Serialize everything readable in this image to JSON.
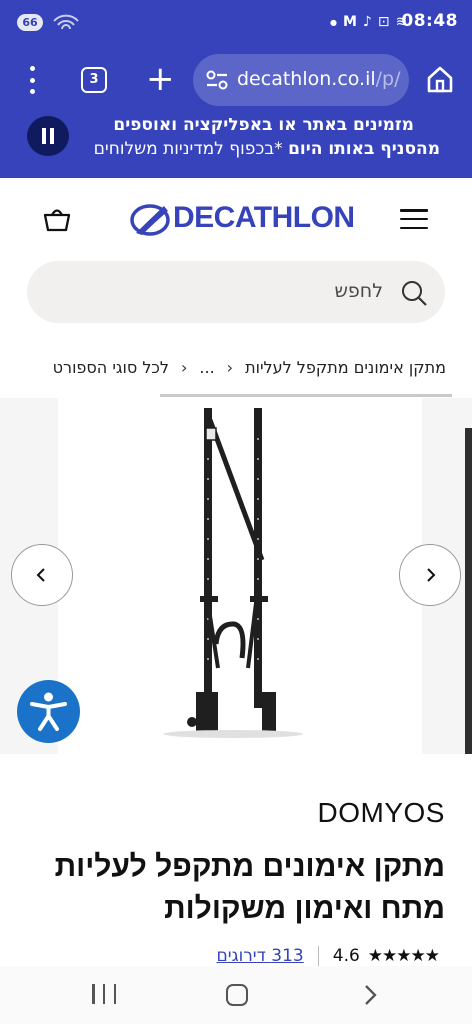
{
  "status_bar": {
    "badge": "66",
    "time": "08:48",
    "icons": [
      "dot-indicator",
      "gmail-icon",
      "tiktok-icon",
      "screenshot-icon",
      "wifi-icon"
    ]
  },
  "browser": {
    "tab_count": "3",
    "url_host": "decathlon.co.il",
    "url_path": "/p/"
  },
  "promo": {
    "line1": "מזמינים באתר או באפליקציה ואוספים",
    "line2_bold": "מהסניף באותו היום",
    "line2_rest": " *בכפוף למדיניות משלוחים"
  },
  "header": {
    "logo_text": "DECATHLON"
  },
  "search": {
    "placeholder": "לחפש"
  },
  "breadcrumb": {
    "items": [
      "לכל סוגי הספורט",
      "...",
      "מתקן אימונים מתקפל לעליות"
    ],
    "separator": "‹"
  },
  "product": {
    "brand": "DOMYOS",
    "title": "מתקן אימונים מתקפל לעליות מתח ואימון משקולות",
    "rating": "4.6",
    "stars": "★★★★★",
    "reviews": "313 דירוגים"
  },
  "colors": {
    "brand_blue": "#3643ba",
    "access_blue": "#1a73c9"
  }
}
